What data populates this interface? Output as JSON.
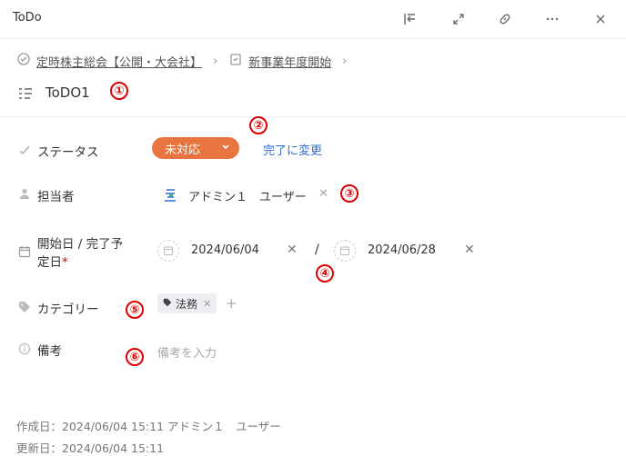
{
  "header": {
    "title": "ToDo"
  },
  "breadcrumb": {
    "parent1": "定時株主総会【公開・大会社】",
    "parent2": "新事業年度開始"
  },
  "task": {
    "name": "ToDO1"
  },
  "fields": {
    "status_label": "ステータス",
    "status_value": "未対応",
    "status_action": "完了に変更",
    "assignee_label": "担当者",
    "assignee_value": "アドミン１　ユーザー",
    "dates_label_line1": "開始日 / 完了予",
    "dates_label_line2": "定日",
    "required_mark": "*",
    "start_date": "2024/06/04",
    "date_separator": "/",
    "end_date": "2024/06/28",
    "category_label": "カテゴリー",
    "category_tag": "法務",
    "add_symbol": "+",
    "note_label": "備考",
    "note_placeholder": "備考を入力"
  },
  "annotations": [
    "①",
    "②",
    "③",
    "④",
    "⑤",
    "⑥"
  ],
  "footer": {
    "created": "作成日：2024/06/04 15:11 アドミン１　ユーザー",
    "updated": "更新日：2024/06/04 15:11"
  },
  "colors": {
    "status": "#e8753f",
    "link": "#2d6cd3",
    "annotation": "#e10000"
  }
}
